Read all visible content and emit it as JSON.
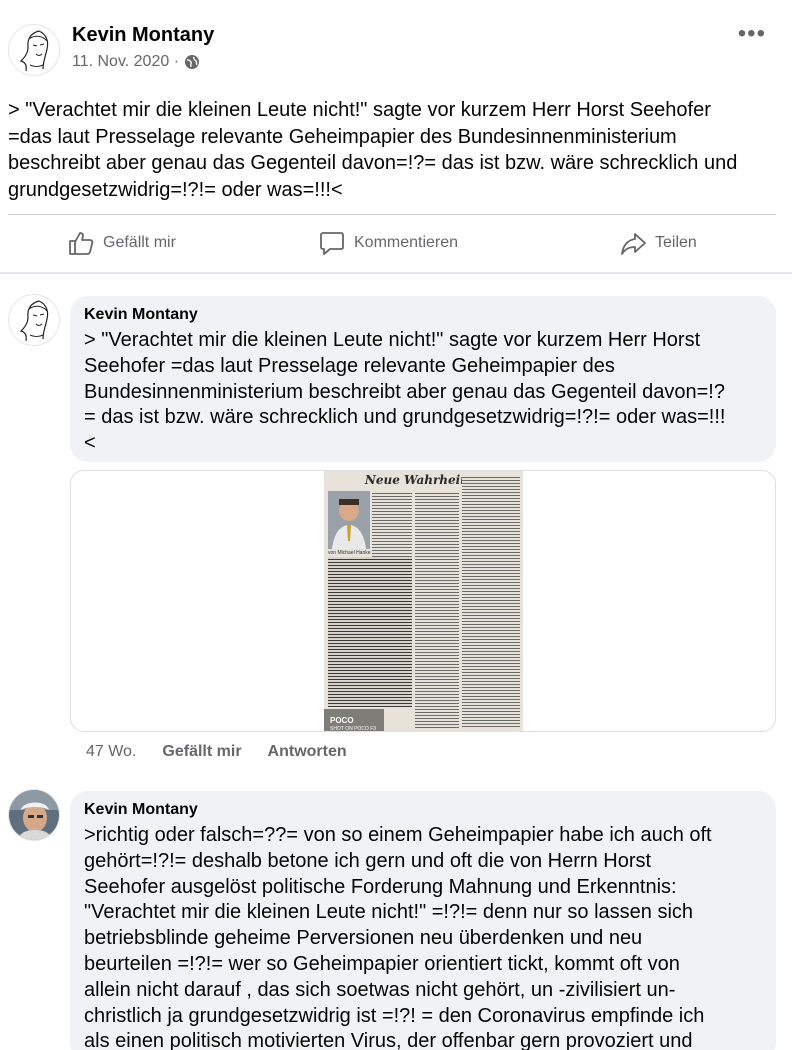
{
  "post": {
    "author": "Kevin Montany",
    "date": "11. Nov. 2020 ·",
    "privacy_icon": "globe-icon",
    "more_label": "•••",
    "text_lines": [
      "> \"Verachtet mir die kleinen Leute nicht!\" sagte vor kurzem Herr Horst Seehofer",
      "=das laut Presselage relevante  Geheimpapier des Bundesinnenministerium",
      "beschreibt aber genau das Gegenteil davon=!?= das ist bzw. wäre schrecklich und",
      "grundgesetzwidrig=!?!= oder was=!!!<"
    ]
  },
  "actions": {
    "like": "Gefällt mir",
    "comment": "Kommentieren",
    "share": "Teilen"
  },
  "comments": [
    {
      "author": "Kevin Montany",
      "text_lines": [
        "> \"Verachtet mir die kleinen Leute nicht!\" sagte vor kurzem Herr Horst",
        "Seehofer =das laut Presselage relevante  Geheimpapier des",
        "Bundesinnenministerium beschreibt aber genau das Gegenteil davon=!?",
        "= das ist bzw. wäre schrecklich und grundgesetzwidrig=!?!= oder was=!!!",
        "<"
      ],
      "image": {
        "headline": "Neue Wahrheiten",
        "caption": "von Michael Hanke",
        "watermark": "POCO",
        "watermark_sub": "SHOT ON POCO F3"
      },
      "time": "47 Wo.",
      "like_label": "Gefällt mir",
      "reply_label": "Antworten"
    },
    {
      "author": "Kevin Montany",
      "text_lines": [
        ">richtig oder falsch=??= von so einem Geheimpapier habe ich auch oft",
        "gehört=!?!= deshalb betone ich gern und oft die von Herrn Horst",
        "Seehofer ausgelöst politische Forderung Mahnung und Erkenntnis:",
        "\"Verachtet mir die kleinen Leute nicht!\" =!?!= denn nur so lassen sich",
        "betriebsblinde geheime  Perversionen neu überdenken und neu",
        "beurteilen =!?!= wer so Geheimpapier orientiert tickt, kommt oft von",
        "allein nicht darauf , das sich soetwas nicht gehört, un -zivilisiert un-",
        "christlich ja grundgesetzwidrig ist =!?! = den Coronavirus empfinde ich",
        "als einen politisch motivierten Virus, der offenbar gern provoziert und"
      ]
    }
  ]
}
